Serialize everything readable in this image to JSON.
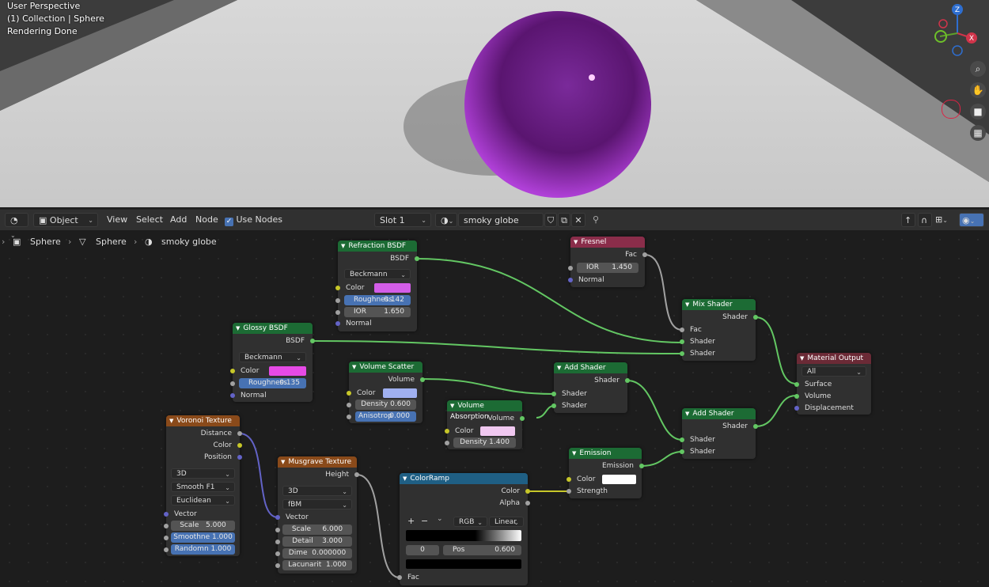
{
  "viewport": {
    "line1": "User Perspective",
    "line2": "(1) Collection | Sphere",
    "line3": "Rendering Done",
    "gizmo": {
      "z": "Z",
      "x": "X"
    }
  },
  "header": {
    "mode": "Object",
    "menu": [
      "View",
      "Select",
      "Add",
      "Node"
    ],
    "use_nodes": "Use Nodes",
    "slot": "Slot 1",
    "material": "smoky globe"
  },
  "breadcrumb": [
    "Sphere",
    "Sphere",
    "smoky globe"
  ],
  "colors": {
    "accent": "#4772b3",
    "shader_green": "#1c6b34",
    "wire": "#63c763"
  },
  "nodes": {
    "refraction": {
      "title": "Refraction BSDF",
      "out": "BSDF",
      "dist": "Beckmann",
      "color": "Color",
      "rough_l": "Roughness",
      "rough_v": "0.142",
      "ior_l": "IOR",
      "ior_v": "1.650",
      "normal": "Normal",
      "swatch": "#d35de8"
    },
    "glossy": {
      "title": "Glossy BSDF",
      "out": "BSDF",
      "dist": "Beckmann",
      "color": "Color",
      "rough_l": "Roughness",
      "rough_v": "0.135",
      "normal": "Normal",
      "swatch": "#e64ae6"
    },
    "fresnel": {
      "title": "Fresnel",
      "out": "Fac",
      "ior_l": "IOR",
      "ior_v": "1.450",
      "normal": "Normal"
    },
    "mix": {
      "title": "Mix Shader",
      "out": "Shader",
      "fac": "Fac",
      "s1": "Shader",
      "s2": "Shader"
    },
    "output": {
      "title": "Material Output",
      "target": "All",
      "surface": "Surface",
      "volume": "Volume",
      "disp": "Displacement"
    },
    "scatter": {
      "title": "Volume Scatter",
      "out": "Volume",
      "color": "Color",
      "dens_l": "Density",
      "dens_v": "0.600",
      "aniso_l": "Anisotrop",
      "aniso_v": "0.000",
      "swatch": "#a0b0f0"
    },
    "absorb": {
      "title": "Volume Absorption",
      "out": "Volume",
      "color": "Color",
      "dens_l": "Density",
      "dens_v": "1.400",
      "swatch": "#f0c8f0"
    },
    "add1": {
      "title": "Add Shader",
      "out": "Shader",
      "s1": "Shader",
      "s2": "Shader"
    },
    "add2": {
      "title": "Add Shader",
      "out": "Shader",
      "s1": "Shader",
      "s2": "Shader"
    },
    "emission": {
      "title": "Emission",
      "out": "Emission",
      "color": "Color",
      "strength": "Strength",
      "swatch": "#ffffff"
    },
    "voronoi": {
      "title": "Voronoi Texture",
      "o1": "Distance",
      "o2": "Color",
      "o3": "Position",
      "dim": "3D",
      "feat": "Smooth F1",
      "metric": "Euclidean",
      "vector": "Vector",
      "scale_l": "Scale",
      "scale_v": "5.000",
      "smooth_l": "Smoothne",
      "smooth_v": "1.000",
      "rand_l": "Randomn",
      "rand_v": "1.000"
    },
    "musgrave": {
      "title": "Musgrave Texture",
      "out": "Height",
      "dim": "3D",
      "type": "fBM",
      "vector": "Vector",
      "scale_l": "Scale",
      "scale_v": "6.000",
      "detail_l": "Detail",
      "detail_v": "3.000",
      "dime_l": "Dime",
      "dime_v": "0.000000",
      "lac_l": "Lacunarit",
      "lac_v": "1.000"
    },
    "ramp": {
      "title": "ColorRamp",
      "o1": "Color",
      "o2": "Alpha",
      "plus": "+",
      "minus": "−",
      "mode": "RGB",
      "interp": "Linear",
      "idx": "0",
      "pos_l": "Pos",
      "pos_v": "0.600",
      "fac": "Fac"
    }
  }
}
